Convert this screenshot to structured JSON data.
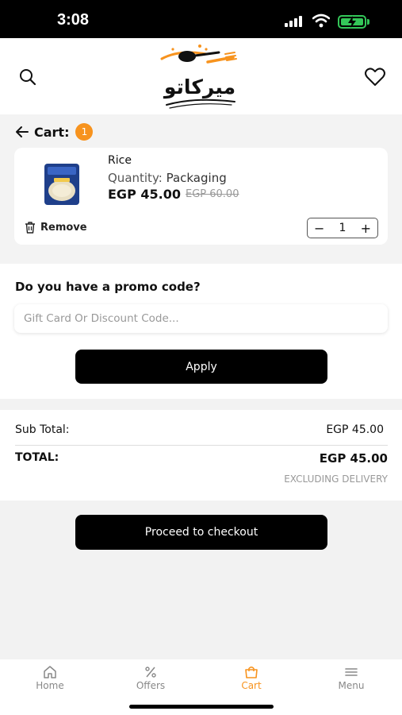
{
  "status_bar": {
    "time": "3:08"
  },
  "header": {
    "logo_text": "ميركاتو",
    "search_icon": "search-icon",
    "wishlist_icon": "heart-icon"
  },
  "cart": {
    "title": "Cart:",
    "count": "1",
    "items": [
      {
        "name": "Rice",
        "quantity_label": "Quantity:",
        "quantity_value": "Packaging",
        "price": "EGP 45.00",
        "old_price": "EGP 60.00",
        "remove_label": "Remove",
        "qty": "1",
        "minus": "−",
        "plus": "+"
      }
    ]
  },
  "promo": {
    "title": "Do you have a promo code?",
    "placeholder": "Gift Card Or Discount Code...",
    "value": "",
    "apply_label": "Apply"
  },
  "totals": {
    "subtotal_label": "Sub Total:",
    "subtotal_value": "EGP 45.00",
    "total_label": "TOTAL:",
    "total_value": "EGP 45.00",
    "delivery_note": "EXCLUDING DELIVERY"
  },
  "checkout": {
    "label": "Proceed to checkout"
  },
  "nav": {
    "items": [
      {
        "label": "Home",
        "icon": "home-icon"
      },
      {
        "label": "Offers",
        "icon": "percent-icon"
      },
      {
        "label": "Cart",
        "icon": "shopping-bag-icon"
      },
      {
        "label": "Menu",
        "icon": "menu-icon"
      }
    ],
    "active": "Cart"
  },
  "colors": {
    "accent": "#f7931e",
    "primary_button": "#000000",
    "battery": "#34c759"
  }
}
